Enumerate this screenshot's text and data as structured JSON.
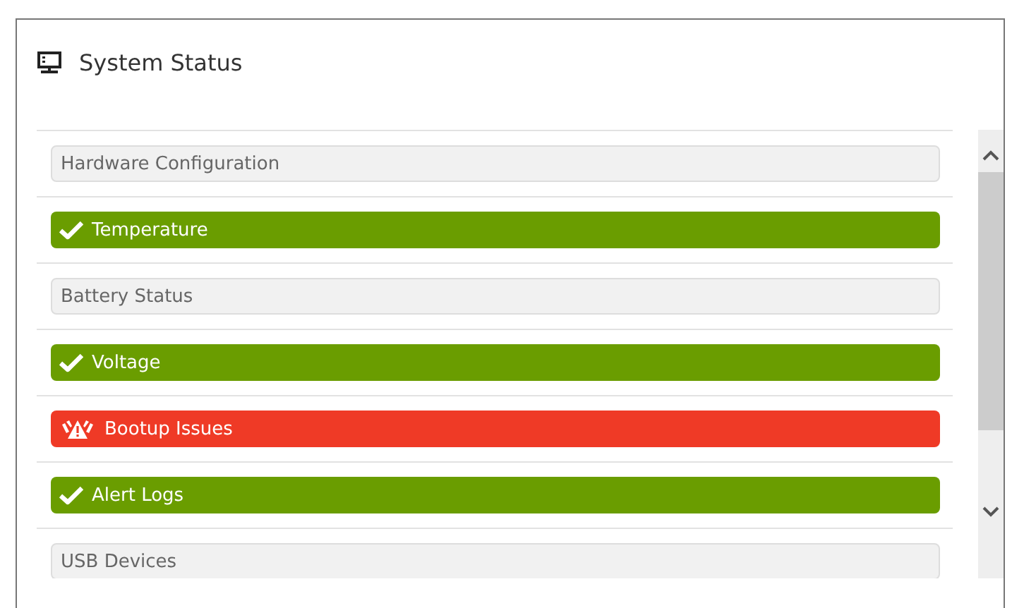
{
  "panel": {
    "title": "System Status"
  },
  "items": [
    {
      "label": "Hardware Configuration",
      "kind": "neutral"
    },
    {
      "label": "Temperature",
      "kind": "ok"
    },
    {
      "label": "Battery Status",
      "kind": "neutral"
    },
    {
      "label": "Voltage",
      "kind": "ok"
    },
    {
      "label": "Bootup Issues",
      "kind": "error"
    },
    {
      "label": "Alert Logs",
      "kind": "ok"
    },
    {
      "label": "USB Devices",
      "kind": "neutral"
    }
  ]
}
